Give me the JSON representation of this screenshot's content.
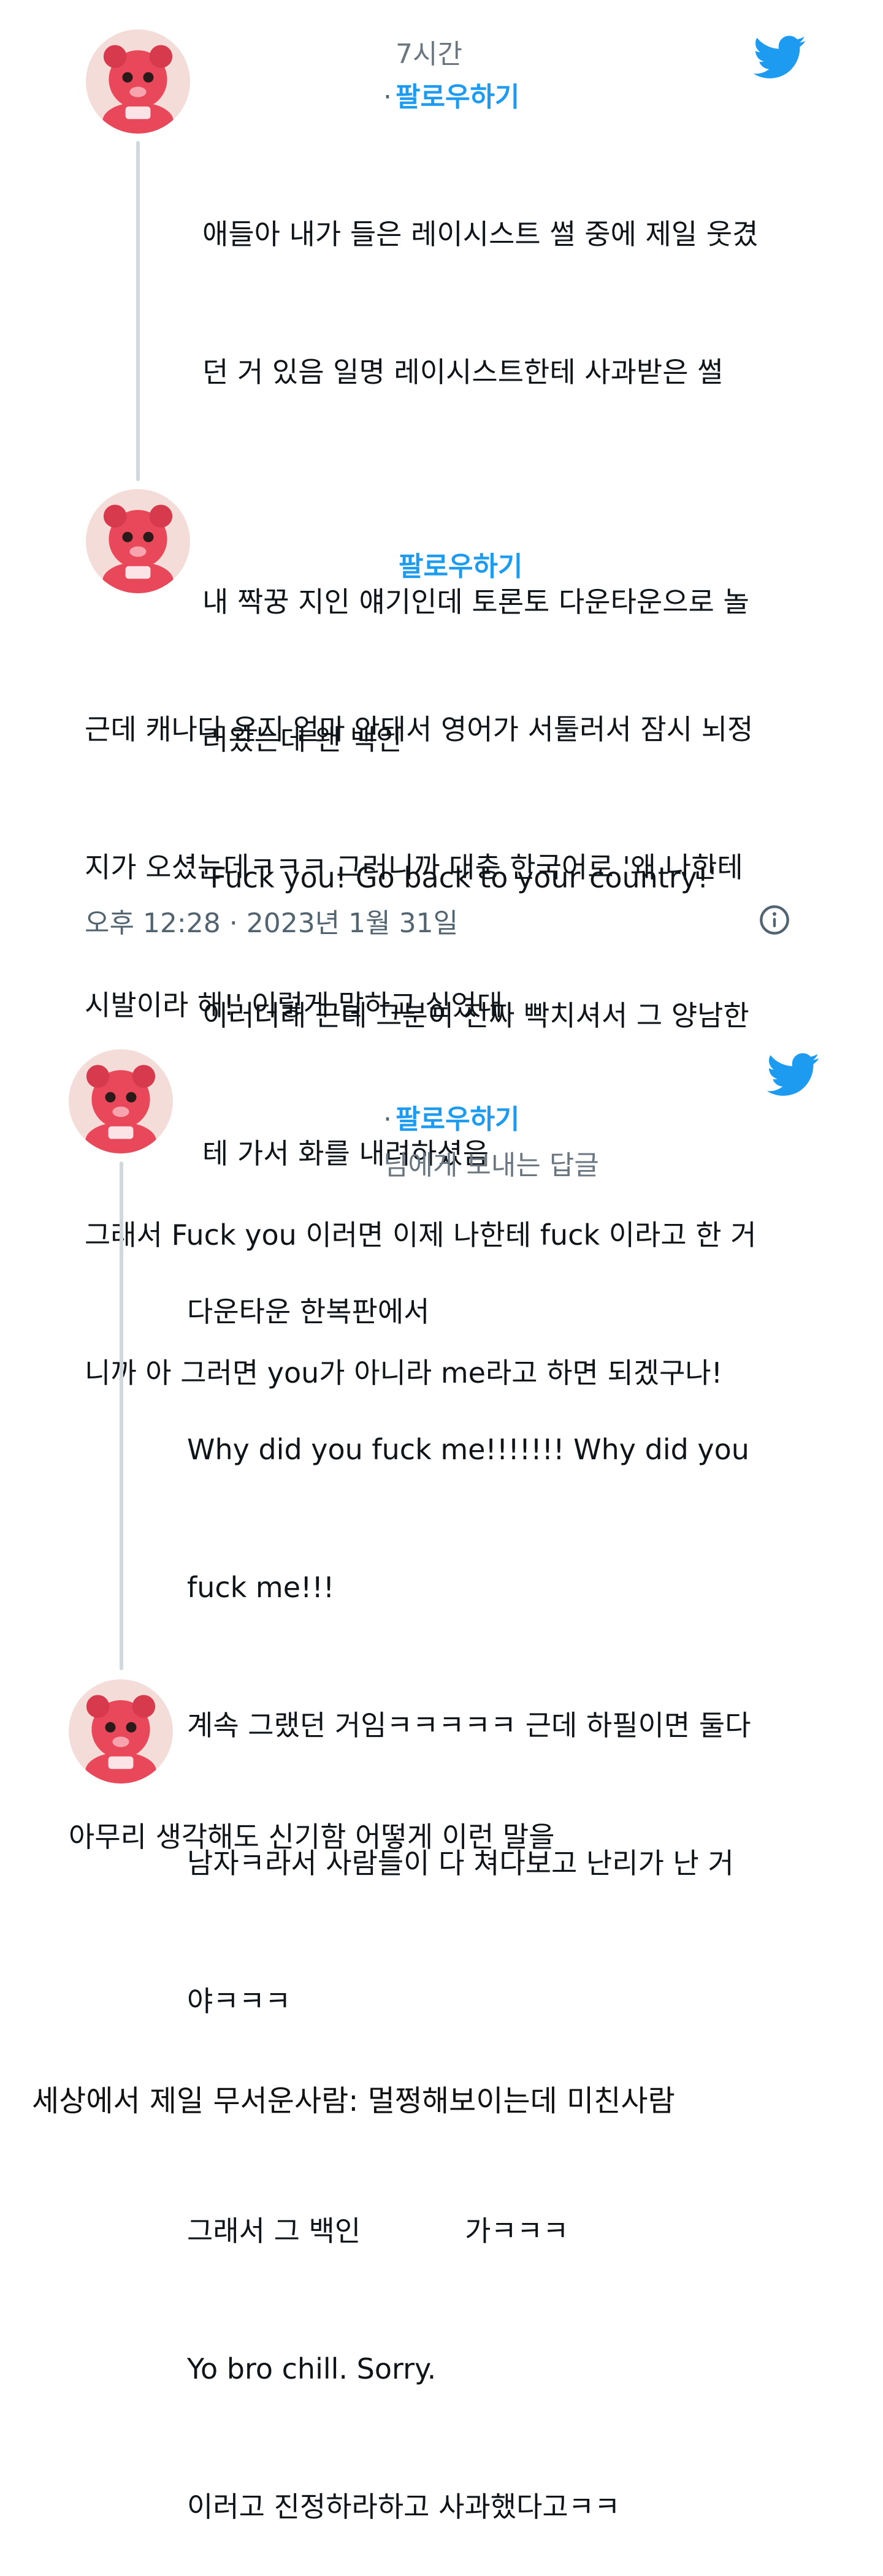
{
  "post1": {
    "time": "7시간",
    "follow_dot": "·",
    "follow_label": "팔로우하기",
    "text_lines": [
      "애들아 내가 들은 레이시스트 썰 중에 제일 웃겼",
      "던 거 있음 일명 레이시스트한테 사과받은 썰",
      "",
      "내 짝꿍 지인 얘기인데 토론토 다운타운으로 놀",
      "러왔는데 왠 백인",
      "'Fuck you! Go back to your country!'",
      "이러더래 근데 그분이 진짜 빡치셔서 그 양남한",
      "테 가서 화를 내려하셨음"
    ]
  },
  "post2": {
    "follow_label": "팔로우하기",
    "text_lines": [
      "근데 캐나다 온지 얼마 안돼서 영어가 서툴러서 잠시 뇌정",
      "지가 오셨는데ㅋㅋㅋ 그러니까 대충 한국어로 '왜 나한테",
      "시발이라 해!' 이렇게 말하고 싶었대",
      "",
      "그래서 Fuck you 이러면 이제 나한테 fuck 이라고 한 거",
      "니까 아 그러면 you가 아니라 me라고 하면 되겠구나!"
    ],
    "timestamp": "오후 12:28 · 2023년 1월 31일"
  },
  "post3": {
    "follow_dot": "·",
    "follow_label": "팔로우하기",
    "reply_to": "님에게 보내는 답글",
    "text_lines": [
      "다운타운 한복판에서",
      "Why did you fuck me!!!!!!! Why did you",
      "fuck me!!!",
      "계속 그랬던 거임ㅋㅋㅋㅋㅋ 근데 하필이면 둘다",
      "남자ㅋ라서 사람들이 다 쳐다보고 난리가 난 거",
      "야ㅋㅋㅋ",
      "",
      "그래서 그 백인",
      "Yo bro chill. Sorry.",
      "이러고 진정하라하고 사과했다고ㅋㅋ"
    ],
    "inline_suffix": "가ㅋㅋㅋ"
  },
  "post4": {
    "text": "아무리 생각해도 신기함 어떻게 이런 말을"
  },
  "caption": "세상에서 제일 무서운사람: 멀쩡해보이는데 미친사람",
  "colors": {
    "twitter_blue": "#1d9bf0",
    "thread_line": "#cfd9de",
    "muted_text": "#536471",
    "avatar_red": "#e8485a"
  },
  "icons": {
    "bird": "twitter-bird-icon",
    "info": "info-icon",
    "avatar": "avatar-character"
  }
}
